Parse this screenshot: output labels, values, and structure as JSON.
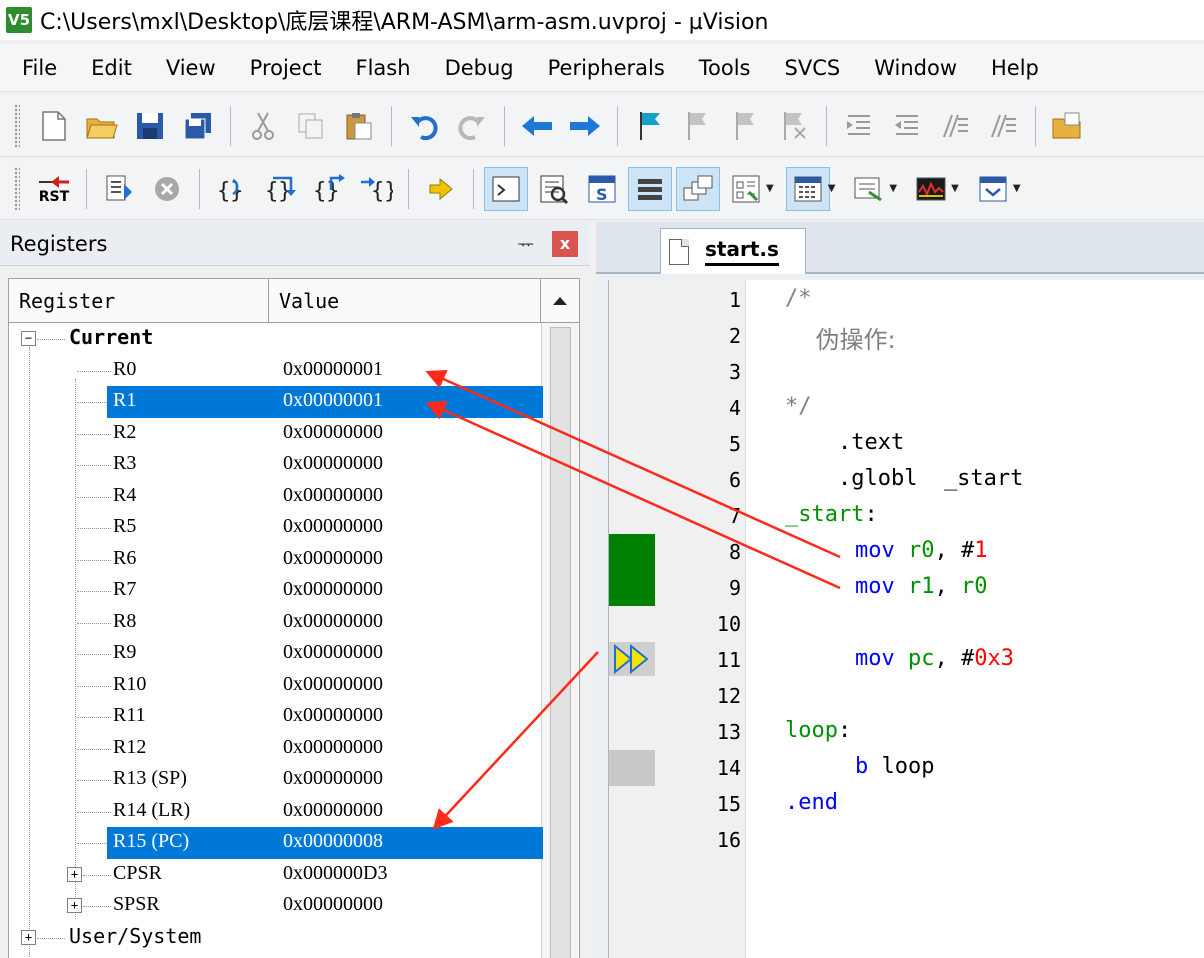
{
  "window": {
    "app_icon_label": "V5",
    "title": "C:\\Users\\mxl\\Desktop\\底层课程\\ARM-ASM\\arm-asm.uvproj - µVision"
  },
  "menu": [
    "File",
    "Edit",
    "View",
    "Project",
    "Flash",
    "Debug",
    "Peripherals",
    "Tools",
    "SVCS",
    "Window",
    "Help"
  ],
  "toolbar1_icons": [
    "new-file-icon",
    "open-folder-icon",
    "save-icon",
    "save-all-icon",
    "cut-icon",
    "copy-icon",
    "paste-icon",
    "undo-icon",
    "redo-icon",
    "navigate-back-icon",
    "navigate-forward-icon",
    "bookmark-icon",
    "bookmark-prev-icon",
    "bookmark-next-icon",
    "bookmark-clear-icon",
    "indent-icon",
    "unindent-icon",
    "comment-icon",
    "uncomment-icon",
    "find-in-files-icon"
  ],
  "toolbar2": {
    "reset_label": "RST",
    "icons": [
      "reset-icon",
      "run-icon",
      "stop-icon",
      "step-into-icon",
      "step-over-icon",
      "step-out-icon",
      "run-to-cursor-icon",
      "show-next-statement-icon",
      "command-window-icon",
      "disassembly-window-icon",
      "symbols-window-icon",
      "registers-window-icon",
      "call-stack-icon",
      "watch-windows-icon",
      "memory-windows-icon",
      "serial-windows-icon",
      "analysis-windows-icon",
      "trace-windows-icon",
      "system-viewer-icon"
    ]
  },
  "registers_panel": {
    "title": "Registers",
    "pin_glyph": "ᅲ",
    "close_glyph": "x",
    "col_register": "Register",
    "col_value": "Value",
    "group_current": "Current",
    "rows": [
      {
        "name": "R0",
        "value": "0x00000001"
      },
      {
        "name": "R1",
        "value": "0x00000001"
      },
      {
        "name": "R2",
        "value": "0x00000000"
      },
      {
        "name": "R3",
        "value": "0x00000000"
      },
      {
        "name": "R4",
        "value": "0x00000000"
      },
      {
        "name": "R5",
        "value": "0x00000000"
      },
      {
        "name": "R6",
        "value": "0x00000000"
      },
      {
        "name": "R7",
        "value": "0x00000000"
      },
      {
        "name": "R8",
        "value": "0x00000000"
      },
      {
        "name": "R9",
        "value": "0x00000000"
      },
      {
        "name": "R10",
        "value": "0x00000000"
      },
      {
        "name": "R11",
        "value": "0x00000000"
      },
      {
        "name": "R12",
        "value": "0x00000000"
      },
      {
        "name": "R13 (SP)",
        "value": "0x00000000"
      },
      {
        "name": "R14 (LR)",
        "value": "0x00000000"
      },
      {
        "name": "R15 (PC)",
        "value": "0x00000008"
      }
    ],
    "cpsr": {
      "name": "CPSR",
      "value": "0x000000D3"
    },
    "spsr": {
      "name": "SPSR",
      "value": "0x00000000"
    },
    "group_user": "User/System"
  },
  "editor": {
    "tab": "start.s",
    "line_numbers": [
      "1",
      "2",
      "3",
      "4",
      "5",
      "6",
      "7",
      "8",
      "9",
      "10",
      "11",
      "12",
      "13",
      "14",
      "15",
      "16"
    ],
    "code": {
      "l1": "/*",
      "l2": "    伪操作:",
      "l4": "*/",
      "l5": "    .text",
      "l6": "    .globl  _start",
      "l7_label": "_start",
      "l7_colon": ":",
      "l8_op": "mov",
      "l8_reg": "r0",
      "l8_sep": ", #",
      "l8_num": "1",
      "l9_op": "mov",
      "l9_reg1": "r1",
      "l9_sep": ", ",
      "l9_reg2": "r0",
      "l11_op": "mov",
      "l11_reg": "pc",
      "l11_sep": ", #",
      "l11_num": "0x3",
      "l13_label": "loop",
      "l13_colon": ":",
      "l14_op": "b",
      "l14_arg": " loop",
      "l15": ".end"
    }
  },
  "colors": {
    "selection": "#0078d7",
    "annotation_arrow": "#ff2a1a",
    "keyword": "#0000ff",
    "register": "#009000",
    "number": "#ff0000"
  }
}
